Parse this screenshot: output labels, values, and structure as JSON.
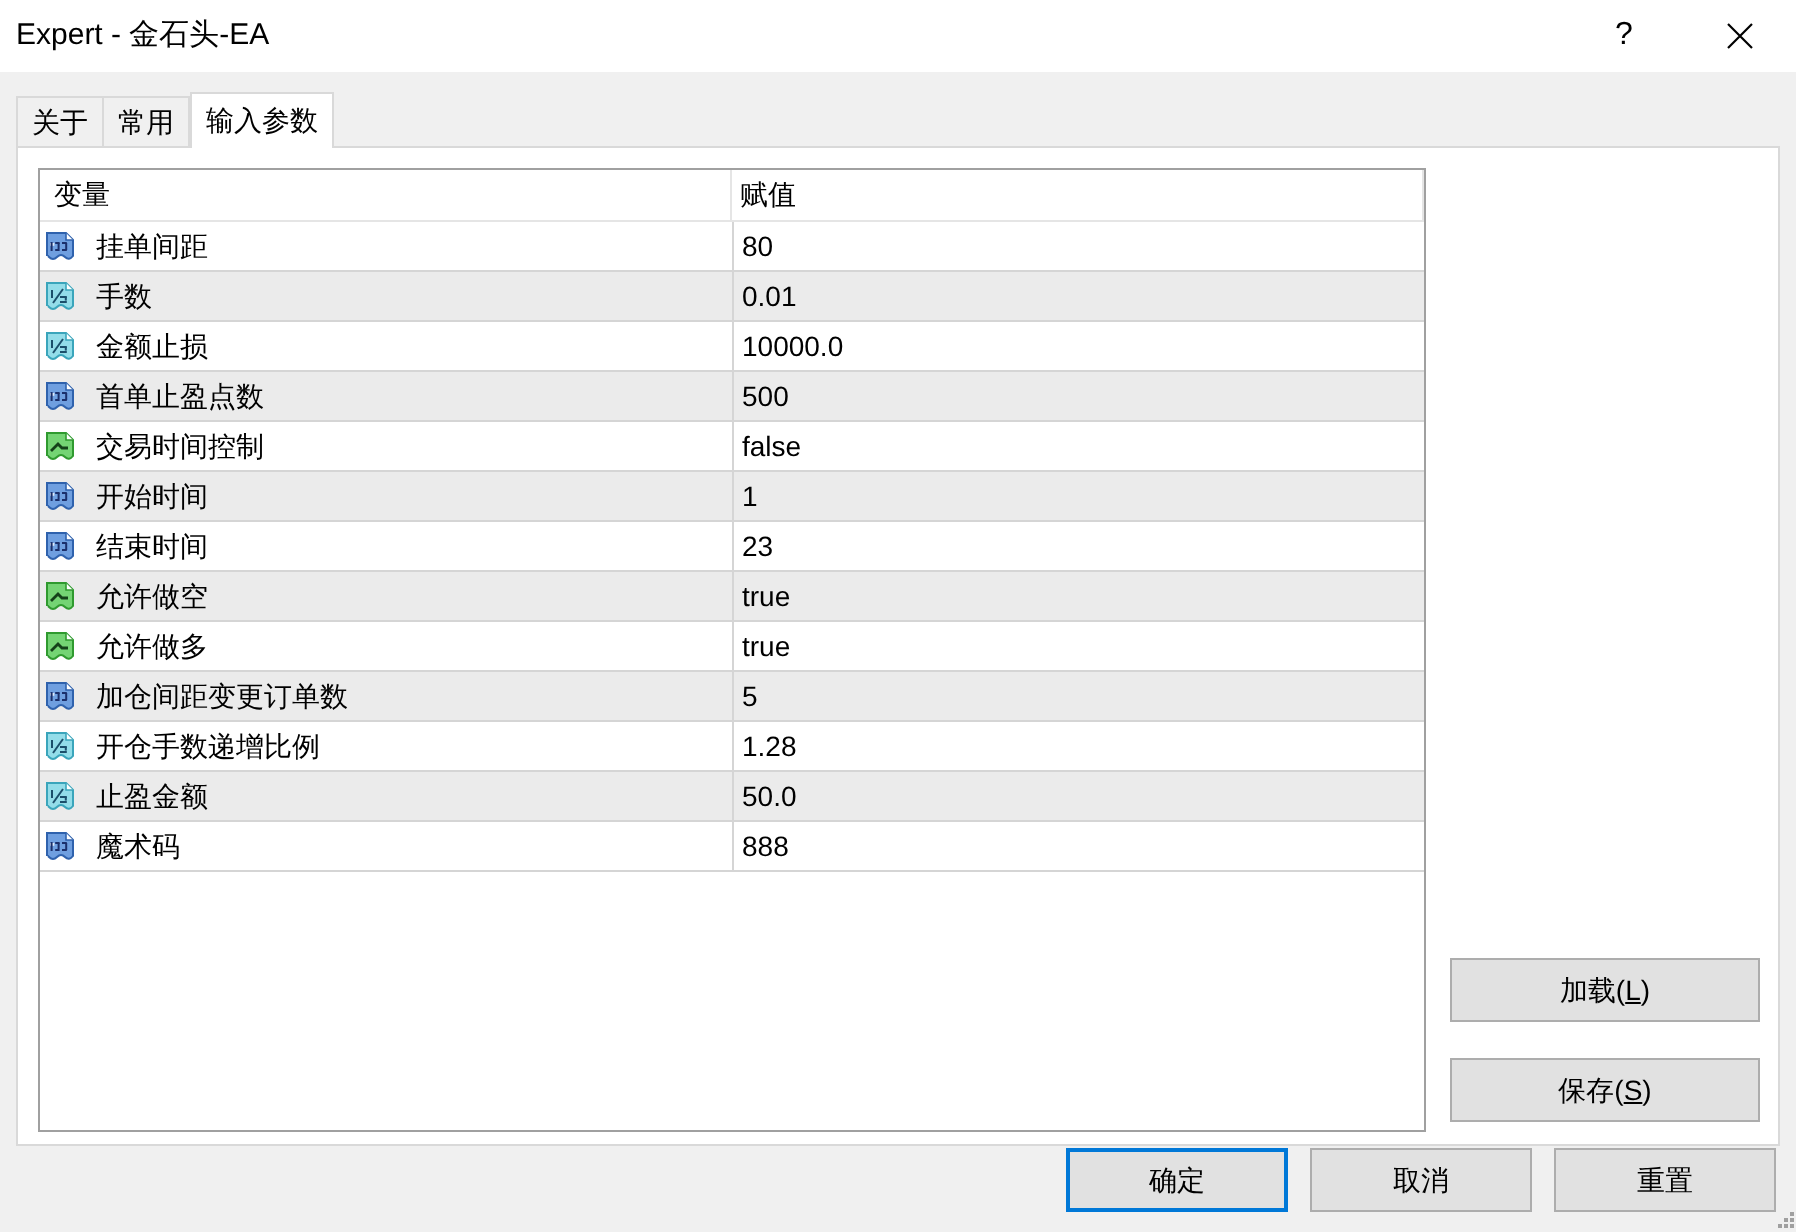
{
  "window": {
    "title": "Expert - 金石头-EA",
    "help_button": "?"
  },
  "tabs": [
    {
      "label": "关于",
      "selected": false
    },
    {
      "label": "常用",
      "selected": false
    },
    {
      "label": "输入参数",
      "selected": true
    }
  ],
  "table": {
    "columns": [
      "变量",
      "赋值"
    ],
    "rows": [
      {
        "kind": "int",
        "name": "挂单间距",
        "value": "80"
      },
      {
        "kind": "double",
        "name": "手数",
        "value": "0.01"
      },
      {
        "kind": "double",
        "name": "金额止损",
        "value": "10000.0"
      },
      {
        "kind": "int",
        "name": "首单止盈点数",
        "value": "500"
      },
      {
        "kind": "bool",
        "name": "交易时间控制",
        "value": "false"
      },
      {
        "kind": "int",
        "name": "开始时间",
        "value": "1"
      },
      {
        "kind": "int",
        "name": "结束时间",
        "value": "23"
      },
      {
        "kind": "bool",
        "name": "允许做空",
        "value": "true"
      },
      {
        "kind": "bool",
        "name": "允许做多",
        "value": "true"
      },
      {
        "kind": "int",
        "name": "加仓间距变更订单数",
        "value": "5"
      },
      {
        "kind": "double",
        "name": "开仓手数递增比例",
        "value": "1.28"
      },
      {
        "kind": "double",
        "name": "止盈金额",
        "value": "50.0"
      },
      {
        "kind": "int",
        "name": "魔术码",
        "value": "888"
      }
    ]
  },
  "side_buttons": [
    {
      "label_before": "加载(",
      "access_key": "L",
      "label_after": ")"
    },
    {
      "label_before": "保存(",
      "access_key": "S",
      "label_after": ")"
    }
  ],
  "dialog_buttons": [
    {
      "label": "确定",
      "default": true
    },
    {
      "label": "取消",
      "default": false
    },
    {
      "label": "重置",
      "default": false
    }
  ]
}
